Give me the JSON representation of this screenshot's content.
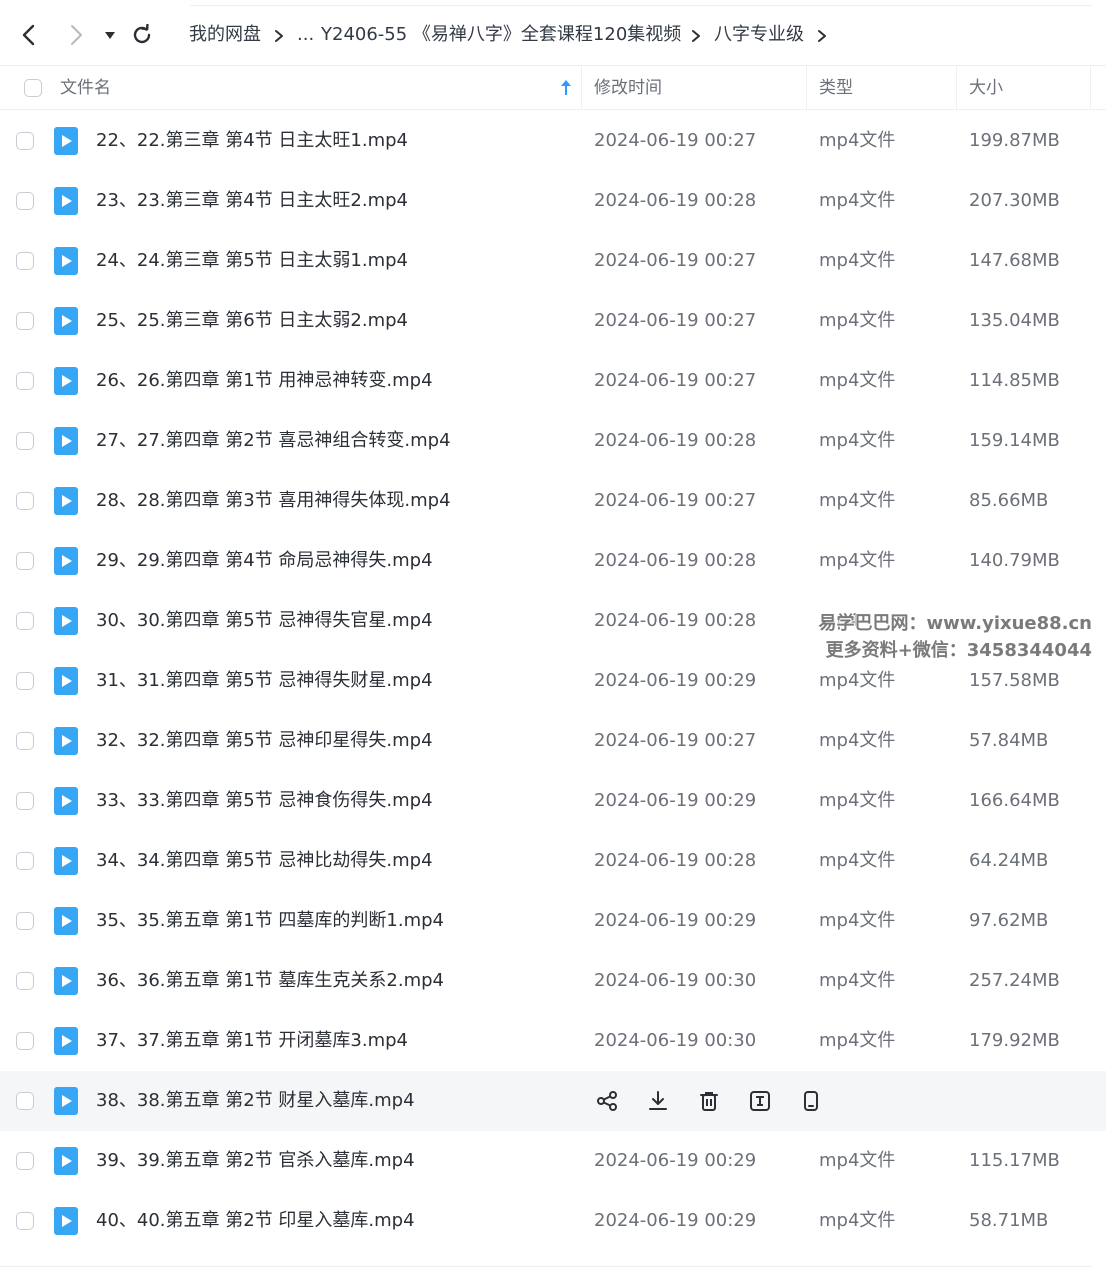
{
  "breadcrumb": {
    "root": "我的网盘",
    "ellipsis": "...",
    "folder": "Y2406-55 《易禅八字》全套课程120集视频",
    "current": "八字专业级"
  },
  "columns": {
    "name": "文件名",
    "modified": "修改时间",
    "type": "类型",
    "size": "大小"
  },
  "files": [
    {
      "name": "22、22.第三章 第4节 日主太旺1.mp4",
      "modified": "2024-06-19 00:27",
      "type": "mp4文件",
      "size": "199.87MB"
    },
    {
      "name": "23、23.第三章 第4节 日主太旺2.mp4",
      "modified": "2024-06-19 00:28",
      "type": "mp4文件",
      "size": "207.30MB"
    },
    {
      "name": "24、24.第三章 第5节 日主太弱1.mp4",
      "modified": "2024-06-19 00:27",
      "type": "mp4文件",
      "size": "147.68MB"
    },
    {
      "name": "25、25.第三章 第6节 日主太弱2.mp4",
      "modified": "2024-06-19 00:27",
      "type": "mp4文件",
      "size": "135.04MB"
    },
    {
      "name": "26、26.第四章 第1节 用神忌神转变.mp4",
      "modified": "2024-06-19 00:27",
      "type": "mp4文件",
      "size": "114.85MB"
    },
    {
      "name": "27、27.第四章 第2节 喜忌神组合转变.mp4",
      "modified": "2024-06-19 00:28",
      "type": "mp4文件",
      "size": "159.14MB"
    },
    {
      "name": "28、28.第四章 第3节 喜用神得失体现.mp4",
      "modified": "2024-06-19 00:27",
      "type": "mp4文件",
      "size": "85.66MB"
    },
    {
      "name": "29、29.第四章 第4节 命局忌神得失.mp4",
      "modified": "2024-06-19 00:28",
      "type": "mp4文件",
      "size": "140.79MB"
    },
    {
      "name": "30、30.第四章 第5节 忌神得失官星.mp4",
      "modified": "2024-06-19 00:28",
      "type": "mp4",
      "size": ""
    },
    {
      "name": "31、31.第四章 第5节 忌神得失财星.mp4",
      "modified": "2024-06-19 00:29",
      "type": "mp4文件",
      "size": "157.58MB"
    },
    {
      "name": "32、32.第四章 第5节 忌神印星得失.mp4",
      "modified": "2024-06-19 00:27",
      "type": "mp4文件",
      "size": "57.84MB"
    },
    {
      "name": "33、33.第四章 第5节 忌神食伤得失.mp4",
      "modified": "2024-06-19 00:29",
      "type": "mp4文件",
      "size": "166.64MB"
    },
    {
      "name": "34、34.第四章 第5节 忌神比劫得失.mp4",
      "modified": "2024-06-19 00:28",
      "type": "mp4文件",
      "size": "64.24MB"
    },
    {
      "name": "35、35.第五章 第1节 四墓库的判断1.mp4",
      "modified": "2024-06-19 00:29",
      "type": "mp4文件",
      "size": "97.62MB"
    },
    {
      "name": "36、36.第五章 第1节 墓库生克关系2.mp4",
      "modified": "2024-06-19 00:30",
      "type": "mp4文件",
      "size": "257.24MB"
    },
    {
      "name": "37、37.第五章 第1节 开闭墓库3.mp4",
      "modified": "2024-06-19 00:30",
      "type": "mp4文件",
      "size": "179.92MB"
    },
    {
      "name": "38、38.第五章 第2节 财星入墓库.mp4",
      "modified": "",
      "type": "",
      "size": "",
      "hover": true
    },
    {
      "name": "39、39.第五章 第2节 官杀入墓库.mp4",
      "modified": "2024-06-19 00:29",
      "type": "mp4文件",
      "size": "115.17MB"
    },
    {
      "name": "40、40.第五章 第2节 印星入墓库.mp4",
      "modified": "2024-06-19 00:29",
      "type": "mp4文件",
      "size": "58.71MB"
    }
  ],
  "row_actions": [
    "share-icon",
    "download-icon",
    "delete-icon",
    "rename-icon",
    "phone-icon"
  ],
  "watermark": {
    "line1": "易学巴巴网：www.yixue88.cn",
    "line2": "更多资料+微信：3458344044"
  },
  "colors": {
    "accent": "#2e9bff",
    "file_icon": "#37a6f4",
    "text": "#2b2f36",
    "muted": "#6b7079",
    "hover_row": "#f5f6f8"
  }
}
